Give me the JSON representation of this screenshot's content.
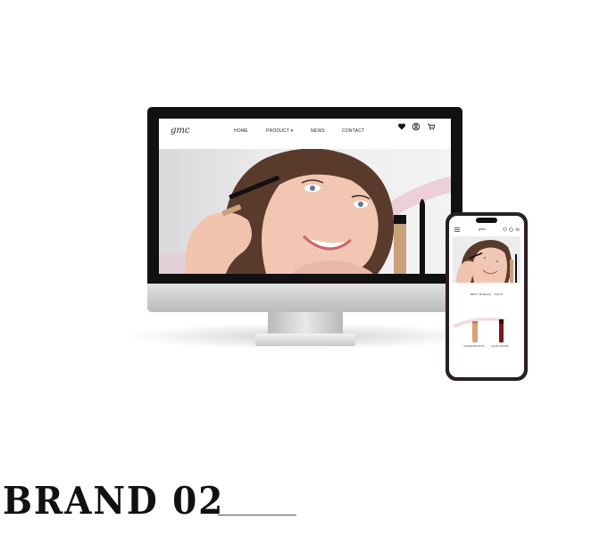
{
  "website": {
    "logo": "gmc",
    "nav": [
      {
        "label": "HOME"
      },
      {
        "label": "PRODUCT ▾"
      },
      {
        "label": "NEWS"
      },
      {
        "label": "CONTACT"
      }
    ],
    "header_icons": [
      "heart-icon",
      "user-icon",
      "cart-icon"
    ],
    "hero_image": "woman-applying-mascara"
  },
  "mobile": {
    "logo": "gmc",
    "section_caption": "BEST MOBILE · SHOP",
    "products": [
      {
        "label": "CONCEALER STICK"
      },
      {
        "label": "LIQUID LIPSTICK"
      }
    ]
  },
  "title": {
    "text": "BRAND 02"
  },
  "colors": {
    "background": "#ffffff",
    "bezel": "#111111",
    "phone_frame": "#2b1f26",
    "accent_pink": "#e8bcc8"
  }
}
